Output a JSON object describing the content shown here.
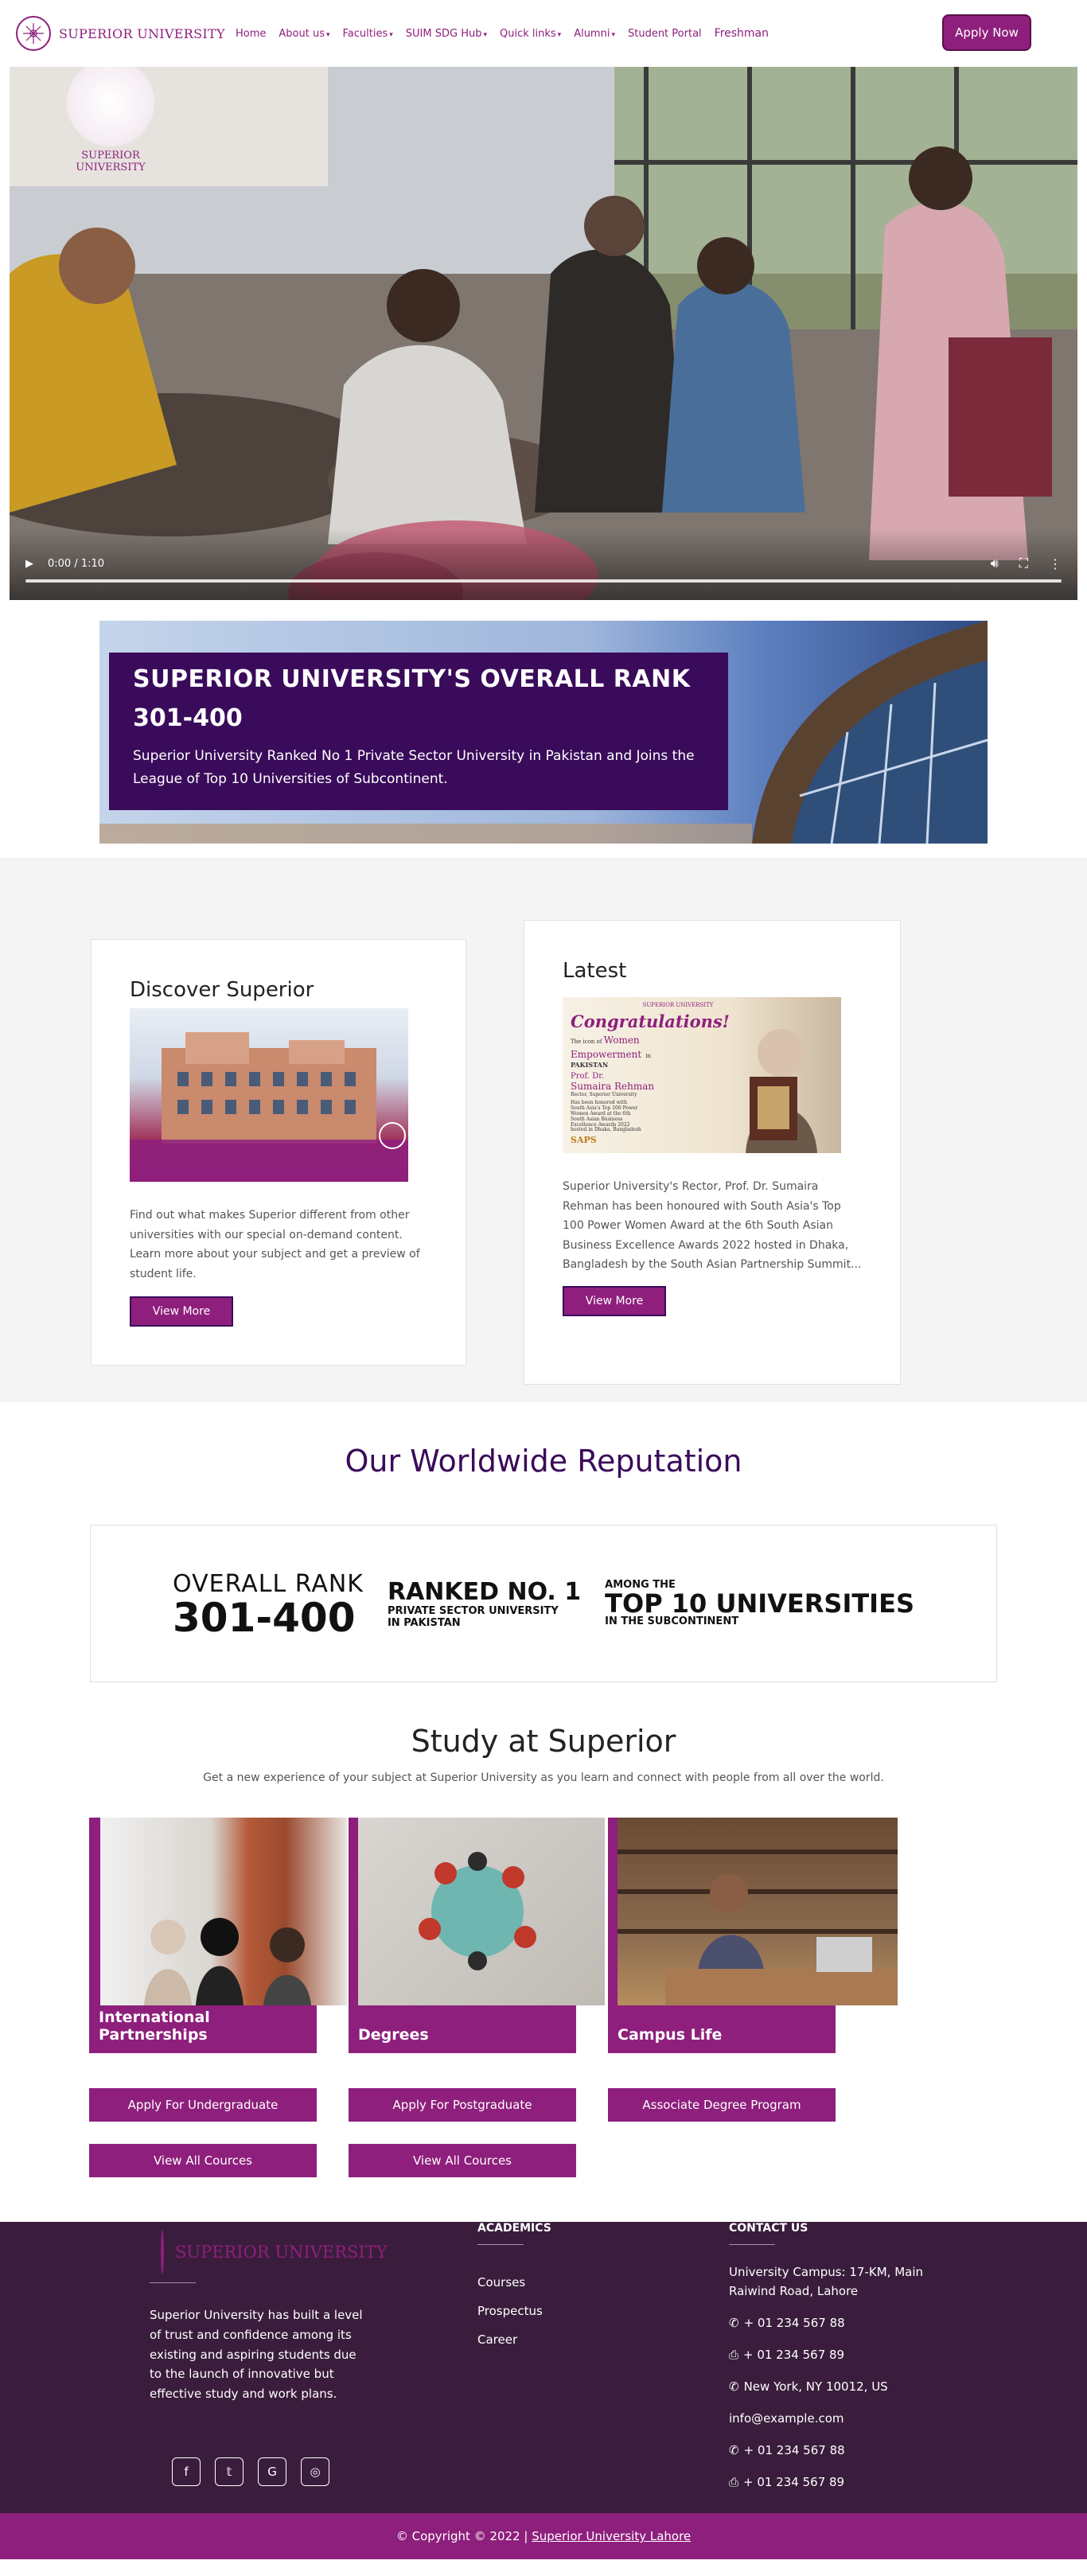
{
  "brand": {
    "name": "SUPERIOR UNIVERSITY",
    "primary": "#8e1f7c",
    "dark": "#3a0b5a"
  },
  "nav": {
    "items": [
      {
        "label": "Home",
        "dropdown": false
      },
      {
        "label": "About us",
        "dropdown": true
      },
      {
        "label": "Faculties",
        "dropdown": true
      },
      {
        "label": "SUIM SDG Hub",
        "dropdown": true
      },
      {
        "label": "Quick links",
        "dropdown": true
      },
      {
        "label": "Alumni",
        "dropdown": true
      },
      {
        "label": "Student Portal",
        "dropdown": false
      },
      {
        "label": "Freshman",
        "dropdown": false
      }
    ],
    "apply_label": "Apply Now"
  },
  "video": {
    "time": "0:00 / 1:10",
    "logo_text": "SUPERIOR UNIVERSITY"
  },
  "rank_banner": {
    "title": "SUPERIOR UNIVERSITY'S OVERALL RANK",
    "number": "301-400",
    "description": "Superior University Ranked No 1 Private Sector University in Pakistan and Joins the League of Top 10 Universities of Subcontinent."
  },
  "discover": {
    "title": "Discover Superior",
    "text": "Find out what makes Superior different from other universities with our special on-demand content. Learn more about your subject and get a preview of student life.",
    "button": "View More"
  },
  "latest": {
    "title": "Latest",
    "image_text": {
      "logo": "SUPERIOR UNIVERSITY",
      "heading": "Congratulations!",
      "line1": "The icon of",
      "line2": "Women",
      "line3": "Empowerment",
      "line4": "in",
      "line5": "PAKISTAN",
      "name1": "Prof. Dr.",
      "name2": "Sumaira Rehman",
      "role": "Rector, Superior University",
      "award": "Has been honored with South Asia's Top 100 Power Women Award at the 6th South Asian Business Excellence Awards 2022 hosted in Dhaka, Bangladesh",
      "saps": "SAPS"
    },
    "text": "Superior University's Rector, Prof. Dr. Sumaira Rehman has been honoured with South Asia's Top 100 Power Women Award at the 6th South Asian Business Excellence Awards 2022 hosted in Dhaka, Bangladesh by the South Asian Partnership Summit...",
    "button": "View More"
  },
  "reputation": {
    "title": "Our Worldwide Reputation",
    "rank_label": "OVERALL RANK",
    "rank_value": "301-400",
    "ranked_head": "RANKED NO. 1",
    "ranked_sub1": "PRIVATE SECTOR UNIVERSITY",
    "ranked_sub2": "IN PAKISTAN",
    "among": "AMONG THE",
    "top10": "TOP 10 UNIVERSITIES",
    "subcontinent": "IN THE SUBCONTINENT"
  },
  "study": {
    "title": "Study at Superior",
    "subtitle": "Get a new experience of your subject at Superior University as you learn and connect with people from all over the world.",
    "cards": [
      {
        "label": "International Partnerships"
      },
      {
        "label": "Degrees"
      },
      {
        "label": "Campus Life"
      }
    ],
    "buttons": [
      "Apply For Undergraduate",
      "Apply For Postgraduate",
      "Associate Degree Program",
      "View All Cources",
      "View All Cources"
    ]
  },
  "footer": {
    "logo_text": "SUPERIOR UNIVERSITY",
    "about": "Superior University has built a level of trust and confidence among its existing and aspiring students due to the launch of innovative but effective study and work plans.",
    "academics_head": "ACADEMICS",
    "academics": [
      "Courses",
      "Prospectus",
      "Career"
    ],
    "contact_head": "CONTACT US",
    "contacts": [
      {
        "icon": "",
        "text": "University Campus: 17-KM, Main Raiwind Road, Lahore"
      },
      {
        "icon": "phone-icon",
        "text": "+ 01 234 567 88"
      },
      {
        "icon": "print-icon",
        "text": "+ 01 234 567 89"
      },
      {
        "icon": "phone-icon",
        "text": "New York, NY 10012, US"
      },
      {
        "icon": "",
        "text": "info@example.com"
      },
      {
        "icon": "phone-icon",
        "text": "+ 01 234 567 88"
      },
      {
        "icon": "print-icon",
        "text": "+ 01 234 567 89"
      }
    ],
    "social": [
      "facebook-icon",
      "twitter-icon",
      "google-icon",
      "instagram-icon"
    ]
  },
  "copyright": {
    "prefix": "© Copyright © 2022 |",
    "link": "Superior University Lahore"
  }
}
